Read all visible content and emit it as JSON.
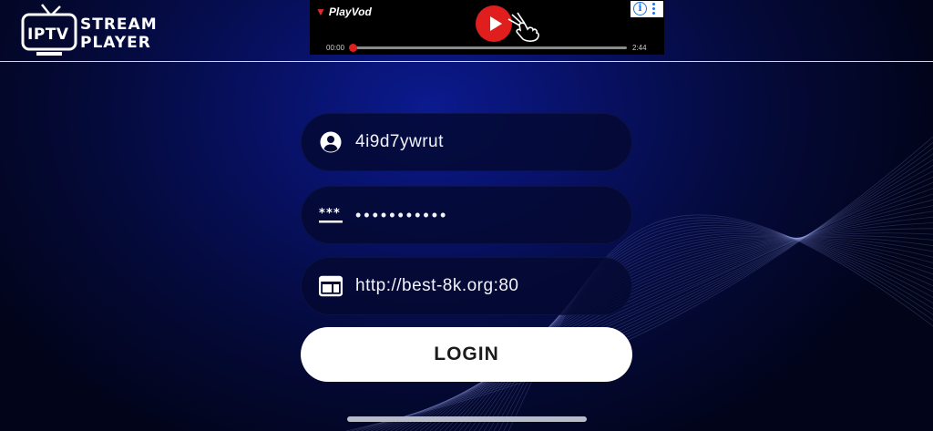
{
  "app": {
    "logo_badge": "IPTV",
    "logo_line_1": "STREAM",
    "logo_line_2": "PLAYER"
  },
  "ad": {
    "brand": "PlayVod",
    "time_start": "00:00",
    "time_end": "2:44",
    "info_glyph": "i",
    "progress": 0,
    "icons": [
      "play-icon",
      "hand-pointer-icon",
      "info-icon",
      "more-vertical-icon"
    ],
    "colors": {
      "play": "#e01e1e",
      "info": "#1a73e8"
    }
  },
  "login": {
    "username": {
      "value": "4i9d7ywrut",
      "icon": "user-circle-icon"
    },
    "password": {
      "value": "•••••••••••",
      "icon": "password-asterisk-icon"
    },
    "server_url": {
      "value": "http://best-8k.org:80",
      "icon": "browser-window-icon"
    },
    "button_label": "LOGIN"
  },
  "colors": {
    "background": "#040a3a",
    "accent_glow": "#0b1a8f",
    "button": "#ffffff",
    "field": "#040830"
  }
}
